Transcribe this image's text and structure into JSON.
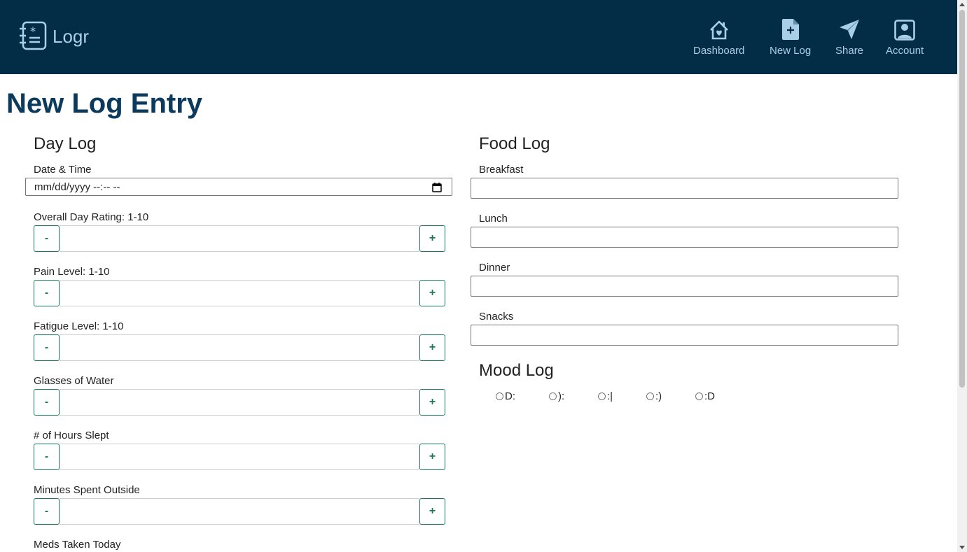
{
  "app": {
    "name": "Logr",
    "logo_icon": "notebook-icon"
  },
  "nav": {
    "items": [
      {
        "label": "Dashboard",
        "icon": "house-heart-icon"
      },
      {
        "label": "New Log",
        "icon": "file-plus-icon"
      },
      {
        "label": "Share",
        "icon": "send-icon"
      },
      {
        "label": "Account",
        "icon": "person-square-icon"
      }
    ],
    "background": "#032d46",
    "link_color": "#a9cfe8"
  },
  "page": {
    "title": "New Log Entry",
    "title_color": "#0b3a5c"
  },
  "day_log": {
    "title": "Day Log",
    "date_label": "Date & Time",
    "date_placeholder": "mm/dd/yyyy --:-- --",
    "steppers": [
      {
        "label": "Overall Day Rating: 1-10",
        "minus": "-",
        "plus": "+"
      },
      {
        "label": "Pain Level: 1-10",
        "minus": "-",
        "plus": "+"
      },
      {
        "label": "Fatigue Level: 1-10",
        "minus": "-",
        "plus": "+"
      },
      {
        "label": "Glasses of Water",
        "minus": "-",
        "plus": "+"
      },
      {
        "label": "# of Hours Slept",
        "minus": "-",
        "plus": "+"
      },
      {
        "label": "Minutes Spent Outside",
        "minus": "-",
        "plus": "+"
      }
    ],
    "meds_label": "Meds Taken Today",
    "button_color": "#197a55"
  },
  "food_log": {
    "title": "Food Log",
    "fields": [
      {
        "label": "Breakfast",
        "value": ""
      },
      {
        "label": "Lunch",
        "value": ""
      },
      {
        "label": "Dinner",
        "value": ""
      },
      {
        "label": "Snacks",
        "value": ""
      }
    ]
  },
  "mood_log": {
    "title": "Mood Log",
    "options": [
      "D:",
      "):",
      ":|",
      ":)",
      ":D"
    ],
    "selected": null
  }
}
